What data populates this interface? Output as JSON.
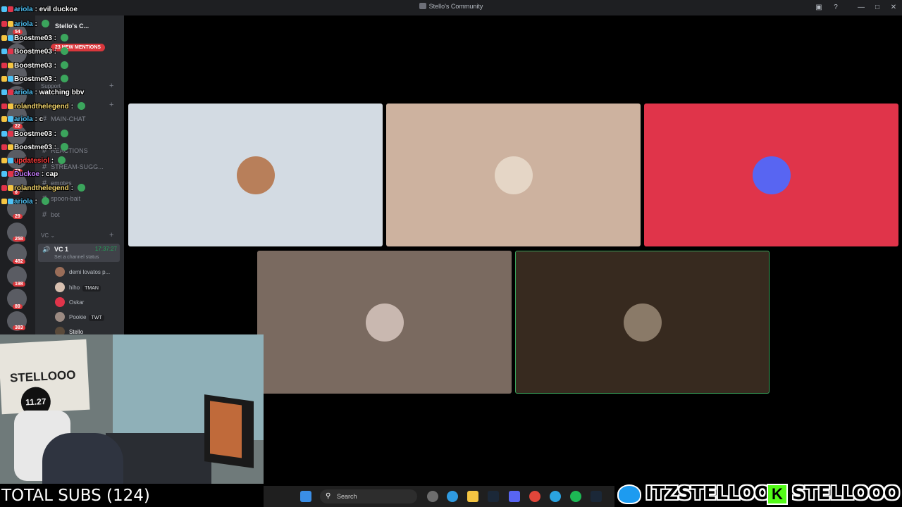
{
  "window": {
    "title": "Stello's Community",
    "controls": [
      "—",
      "□",
      "✕"
    ]
  },
  "sidebar": {
    "server_name": "Stello's C...",
    "mentions_pill": "23 NEW MENTIONS",
    "server_badges": [
      "54",
      "22",
      "73",
      "8",
      "29",
      "258",
      "482",
      "198",
      "89",
      "383"
    ],
    "categories": {
      "support": "Support",
      "vc": "VC"
    },
    "channels": [
      "MAIN-CHAT",
      "REACTIONS",
      "STREAM-SUGG...",
      "emotes",
      "spoon-bait",
      "bot"
    ],
    "voice_channel": {
      "name": "VC 1",
      "timer": "17:37:27",
      "status": "Set a channel status"
    },
    "members": [
      {
        "name": "demi lovatos p...",
        "tag": ""
      },
      {
        "name": "hiho",
        "tag": "TMAN"
      },
      {
        "name": "Oskar",
        "tag": ""
      },
      {
        "name": "Pookie",
        "tag": "TWT"
      },
      {
        "name": "Stello",
        "tag": ""
      }
    ]
  },
  "chat": [
    {
      "user": "ariola",
      "msg": "evil duckoe",
      "color": "#4fc3f7"
    },
    {
      "user": "ariola",
      "msg": "",
      "color": "#4fc3f7"
    },
    {
      "user": "Boostme03",
      "msg": "",
      "color": "#ffffff"
    },
    {
      "user": "Boostme03",
      "msg": "",
      "color": "#ffffff"
    },
    {
      "user": "Boostme03",
      "msg": "",
      "color": "#ffffff"
    },
    {
      "user": "Boostme03",
      "msg": "",
      "color": "#ffffff"
    },
    {
      "user": "ariola",
      "msg": "watching bbv",
      "color": "#4fc3f7"
    },
    {
      "user": "rolandthelegend",
      "msg": "",
      "color": "#f5d76e"
    },
    {
      "user": "ariola",
      "msg": "c",
      "color": "#4fc3f7"
    },
    {
      "user": "Boostme03",
      "msg": "",
      "color": "#ffffff"
    },
    {
      "user": "Boostme03",
      "msg": "",
      "color": "#ffffff"
    },
    {
      "user": "updatesiol",
      "msg": "",
      "color": "#ff3b3b"
    },
    {
      "user": "Duckoe",
      "msg": "cap",
      "color": "#c77dff"
    },
    {
      "user": "rolandthelegend",
      "msg": "",
      "color": "#f5d76e"
    },
    {
      "user": "ariola",
      "msg": "",
      "color": "#4fc3f7"
    }
  ],
  "tiles": [
    {
      "bg": "#d3dbe3",
      "avatar": "#b87f5a",
      "speaking": false
    },
    {
      "bg": "#cdb29f",
      "avatar": "#e5d6c6",
      "speaking": false
    },
    {
      "bg": "#e0344a",
      "avatar": "#5865f2",
      "speaking": false
    },
    {
      "bg": "#7a6a60",
      "avatar": "#c9b8b0",
      "speaking": false
    },
    {
      "bg": "#372a1f",
      "avatar": "#8a7a68",
      "speaking": true
    }
  ],
  "webcam": {
    "banner_text": "STELLOOO",
    "circle_text": "11.27"
  },
  "taskbar": {
    "search_placeholder": "Search"
  },
  "overlay": {
    "total_subs": "TOTAL SUBS (124)",
    "twitter_handle": "ITZSTELLOO",
    "kick_handle": "STELLOOO",
    "kick_letter": "K"
  },
  "colors": {
    "speaking_border": "#3ba55c",
    "discord_blurple": "#5865f2",
    "kick_green": "#53fc18",
    "twitter_blue": "#1d9bf0"
  }
}
